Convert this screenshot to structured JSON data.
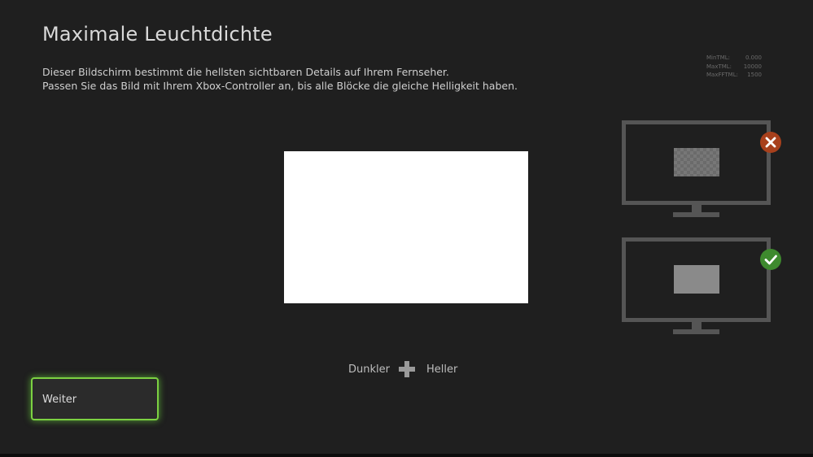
{
  "title": "Maximale Leuchtdichte",
  "description": [
    "Dieser Bildschirm bestimmt die hellsten sichtbaren Details auf Ihrem Fernseher.",
    "Passen Sie das Bild mit Ihrem Xbox-Controller an, bis alle Blöcke die gleiche Helligkeit haben."
  ],
  "stats": [
    {
      "label": "MinTML:",
      "value": "0.000"
    },
    {
      "label": "MaxTML:",
      "value": "10000"
    },
    {
      "label": "MaxFFTML:",
      "value": "1500"
    }
  ],
  "examples": {
    "bad_icon": "close-icon",
    "good_icon": "check-icon",
    "bad_color": "#a8401c",
    "good_color": "#3e8a2e"
  },
  "adjust": {
    "darker_label": "Dunkler",
    "brighter_label": "Heller",
    "icon": "dpad-icon"
  },
  "continue_button": {
    "label": "Weiter",
    "focus_color": "#7cd142"
  },
  "colors": {
    "background": "#1f1f1f",
    "test_block": "#ffffff"
  }
}
